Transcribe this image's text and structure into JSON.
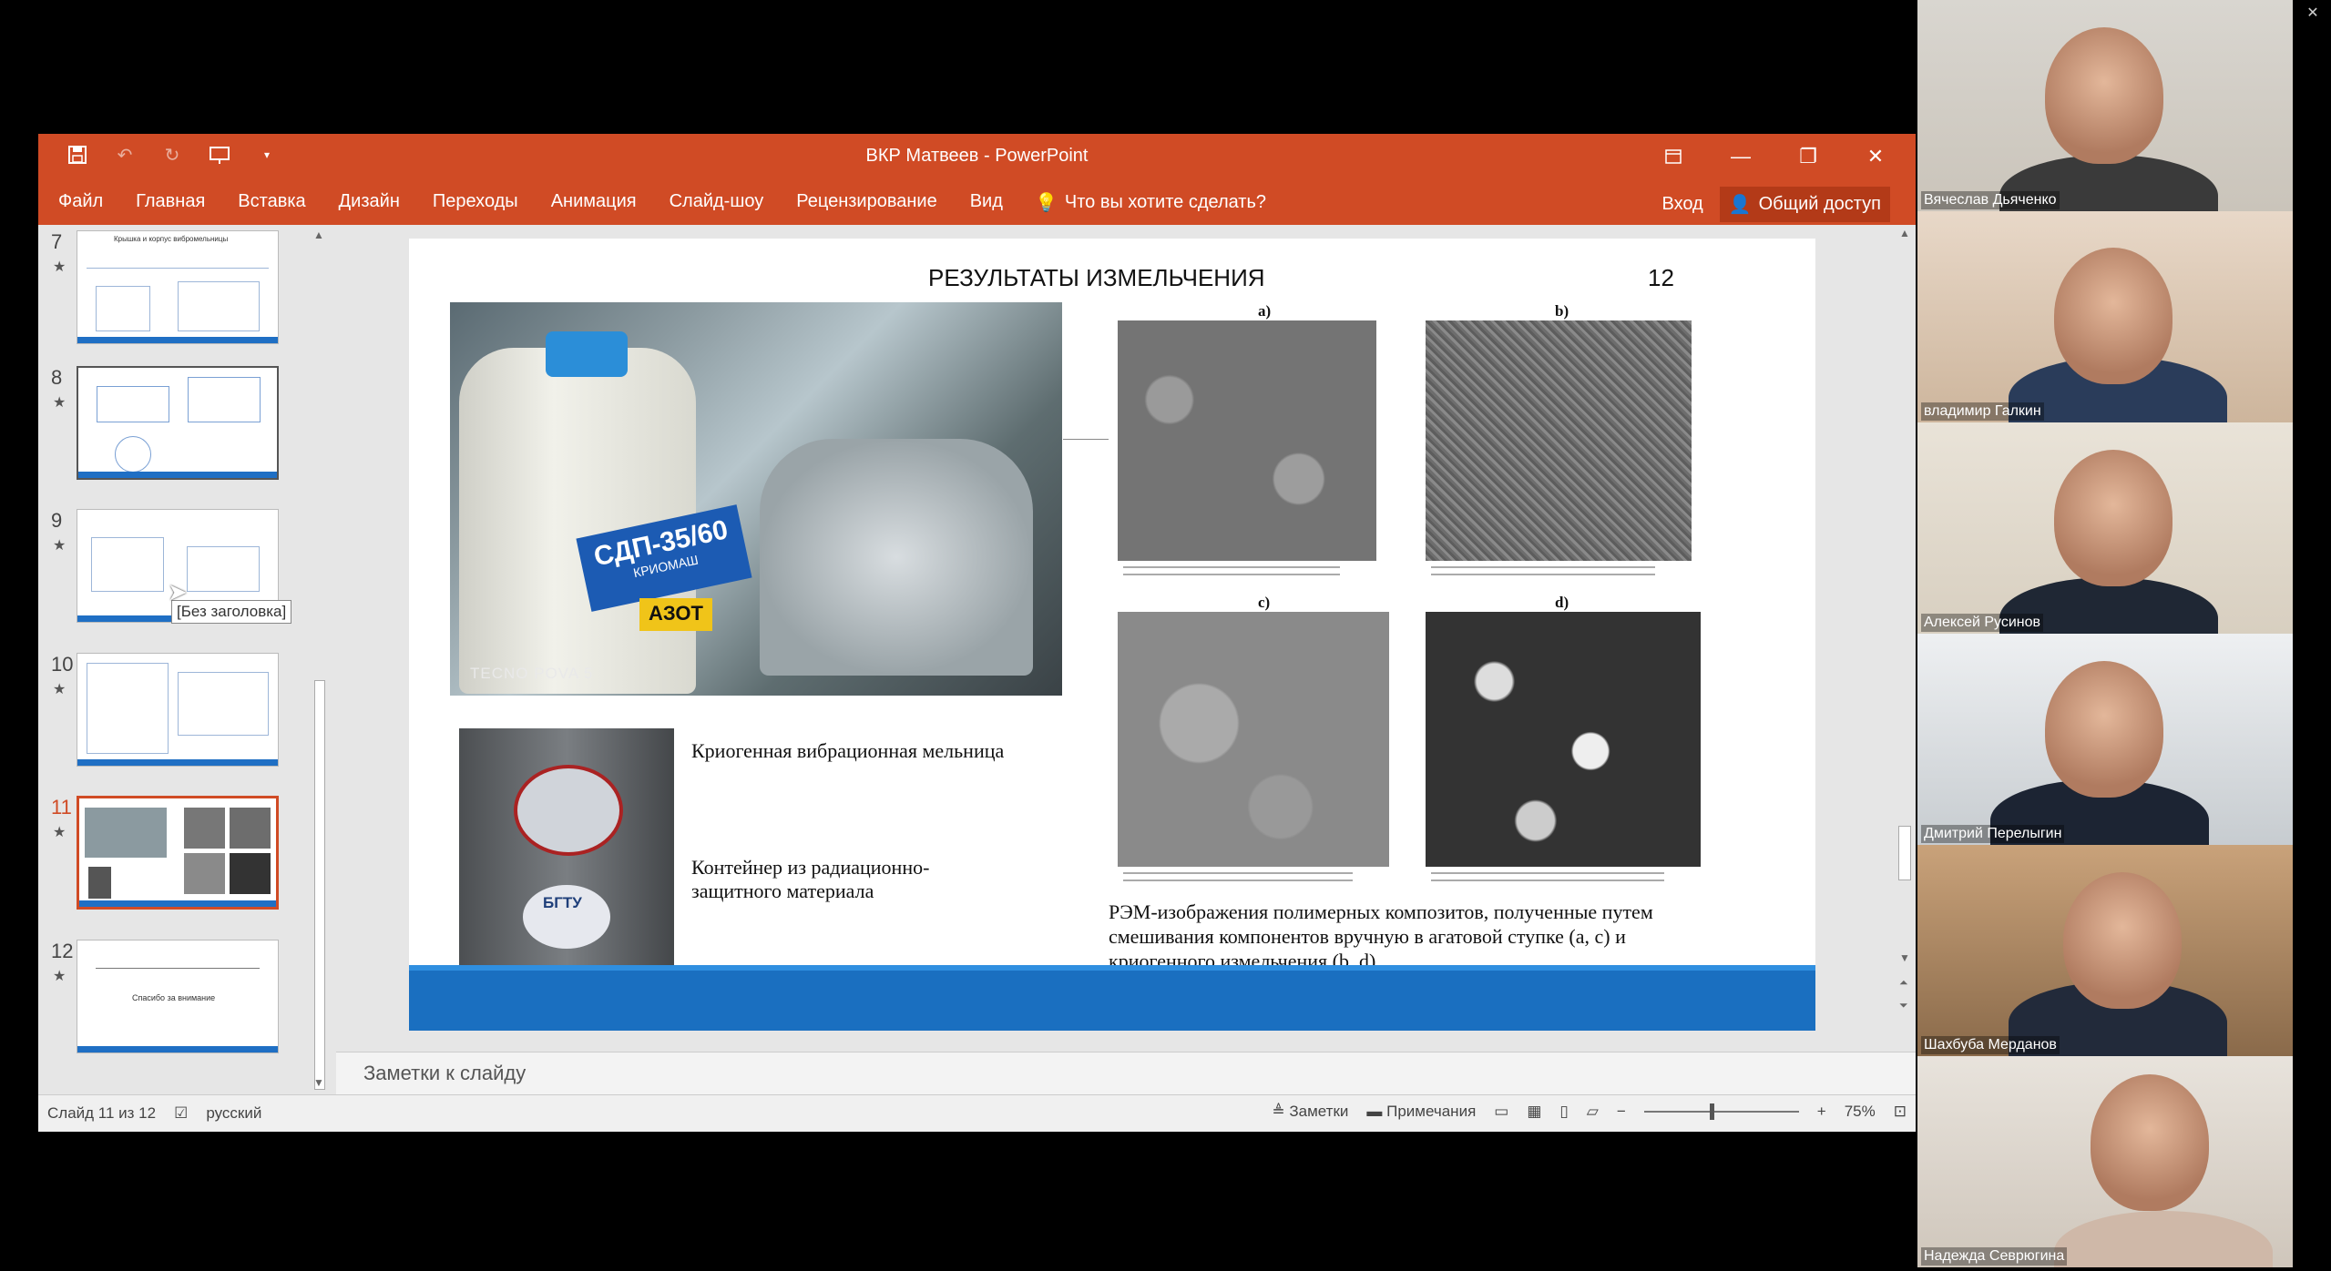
{
  "host": {
    "controls": [
      "–",
      "❐",
      "✕"
    ]
  },
  "ppt": {
    "window_title": "ВКР Матвеев - PowerPoint",
    "ribbon_tabs": [
      "Файл",
      "Главная",
      "Вставка",
      "Дизайн",
      "Переходы",
      "Анимация",
      "Слайд-шоу",
      "Рецензирование",
      "Вид"
    ],
    "tell_me": "Что вы хотите сделать?",
    "signin": "Вход",
    "share": "Общий доступ",
    "thumbs": [
      {
        "num": "7",
        "title": "Крышка и корпус вибромельницы"
      },
      {
        "num": "8"
      },
      {
        "num": "9"
      },
      {
        "num": "10"
      },
      {
        "num": "11"
      },
      {
        "num": "12",
        "title": "Спасибо за внимание"
      }
    ],
    "tooltip": "[Без заголовка]",
    "slide": {
      "title": "РЕЗУЛЬТАТЫ ИЗМЕЛЬЧЕНИЯ",
      "number": "12",
      "dewar_label": "СДП-35/60",
      "dewar_brand": "КРИОМАШ",
      "azot": "АЗОТ",
      "watermark": "TECNO POVA 5",
      "bgtu": "БГТУ",
      "caption_mill": "Криогенная вибрационная мельница",
      "caption_container": "Контейнер из радиационно-защитного материала",
      "sem_labels": [
        "a)",
        "b)",
        "c)",
        "d)"
      ],
      "caption_sem": "РЭМ-изображения полимерных композитов, полученные путем смешивания компонентов вручную в агатовой ступке (a, c) и криогенного измельчения (b, d)."
    },
    "notes_placeholder": "Заметки к слайду",
    "status": {
      "slide_of": "Слайд 11 из 12",
      "language": "русский",
      "notes_btn": "Заметки",
      "comments_btn": "Примечания",
      "zoom": "75%",
      "zoom_fraction": 0.75
    }
  },
  "participants": [
    {
      "name": "Вячеслав Дьяченко"
    },
    {
      "name": "владимир Галкин"
    },
    {
      "name": "Алексей Русинов"
    },
    {
      "name": "Дмитрий Перелыгин"
    },
    {
      "name": "Шахбуба Мерданов"
    },
    {
      "name": "Надежда Севрюгина"
    }
  ]
}
